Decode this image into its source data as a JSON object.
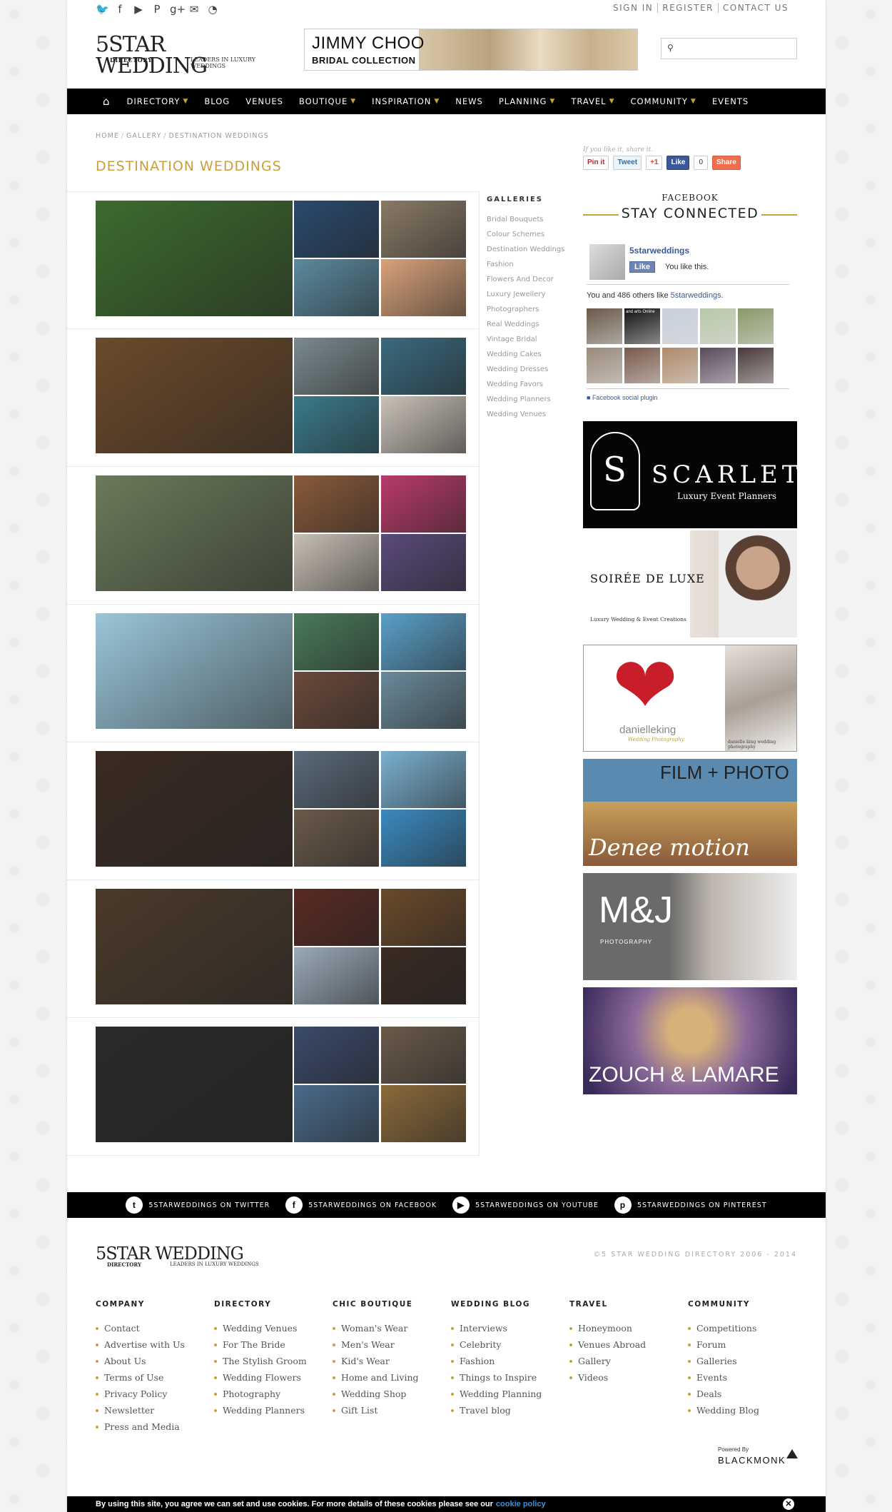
{
  "header": {
    "social_icons": [
      "twitter-icon",
      "facebook-icon",
      "youtube-icon",
      "pinterest-icon",
      "google-plus-icon",
      "mail-icon",
      "rss-icon"
    ],
    "top_links": [
      "SIGN IN",
      "REGISTER",
      "CONTACT US"
    ],
    "logo": {
      "main": "5STAR WEDDING",
      "sub_left": "DIRECTORY",
      "sub_right": "LEADERS IN LUXURY WEDDINGS"
    },
    "banner": {
      "line1": "JIMMY CHOO",
      "line2": "BRIDAL COLLECTION"
    },
    "search": {
      "placeholder": ""
    }
  },
  "nav": {
    "items": [
      {
        "label": "DIRECTORY",
        "dropdown": true
      },
      {
        "label": "BLOG",
        "dropdown": false
      },
      {
        "label": "VENUES",
        "dropdown": false
      },
      {
        "label": "BOUTIQUE",
        "dropdown": true
      },
      {
        "label": "INSPIRATION",
        "dropdown": true
      },
      {
        "label": "NEWS",
        "dropdown": false
      },
      {
        "label": "PLANNING",
        "dropdown": true
      },
      {
        "label": "TRAVEL",
        "dropdown": true
      },
      {
        "label": "COMMUNITY",
        "dropdown": true
      },
      {
        "label": "EVENTS",
        "dropdown": false
      }
    ]
  },
  "breadcrumb": [
    "HOME",
    "GALLERY",
    "DESTINATION WEDDINGS"
  ],
  "page_title": "DESTINATION WEDDINGS",
  "gallery_rows": [
    {
      "colors": [
        "#3d6b2e",
        "#2a4a6e",
        "#8a7a66",
        "#5b8a9e",
        "#d9a27a"
      ]
    },
    {
      "colors": [
        "#6b4a2a",
        "#7a8a8e",
        "#3a6a7e",
        "#3a7a8a",
        "#c9c2b8"
      ]
    },
    {
      "colors": [
        "#6a7a5a",
        "#8a5a3a",
        "#b93a6a",
        "#c8c0b5",
        "#5a4a7a"
      ]
    },
    {
      "colors": [
        "#9ac6d8",
        "#4a7a5a",
        "#5aa0c8",
        "#6a4a3a",
        "#6a8a9a"
      ]
    },
    {
      "colors": [
        "#3a2a22",
        "#5a6a7a",
        "#7ab0d0",
        "#6a5a4a",
        "#3a8ac0"
      ]
    },
    {
      "colors": [
        "#4a3a2a",
        "#5a2a22",
        "#6a4a2a",
        "#9aaab8",
        "#3a2a22"
      ]
    },
    {
      "colors": [
        "#2a2a2a",
        "#3a4a6a",
        "#6a5a4a",
        "#4a6a8a",
        "#8a6a3a"
      ]
    }
  ],
  "galleries": {
    "heading": "GALLERIES",
    "items": [
      "Bridal Bouquets",
      "Colour Schemes",
      "Destination Weddings",
      "Fashion",
      "Flowers And Decor",
      "Luxury Jewellery",
      "Photographers",
      "Real Weddings",
      "Vintage Bridal",
      "Wedding Cakes",
      "Wedding Dresses",
      "Wedding Favors",
      "Wedding Planners",
      "Wedding Venues"
    ]
  },
  "share": {
    "prompt": "If you like it, share it.",
    "pin": "Pin it",
    "tweet": "Tweet",
    "gplus": "+1",
    "like": "Like",
    "like_count": "0",
    "share": "Share"
  },
  "facebook": {
    "label": "FACEBOOK",
    "heading": "STAY CONNECTED",
    "page_name": "5starweddings",
    "like_button": "Like",
    "you_like": "You like this.",
    "others_prefix": "You and 486 others like ",
    "others_link": "5starweddings.",
    "plugin": "Facebook social plugin",
    "face_colors": [
      "#6a5a4a",
      "#111",
      "#c8d0dc",
      "#b8c8a8",
      "#8a9a6a",
      "#9a8a7a",
      "#7a5a4a",
      "#b08a6a",
      "#5a4a5a",
      "#4a3a3a"
    ],
    "face_caption": "and arts Online"
  },
  "ads": [
    {
      "title": "SCARLET",
      "subtitle": "Luxury Event Planners",
      "monogram": "S"
    },
    {
      "title": "SOIRÉE DE LUXE",
      "subtitle": "Luxury Wedding & Event Creations"
    },
    {
      "title": "danielleking",
      "subtitle": "Wedding Photography",
      "caption": "danielle king wedding photography"
    },
    {
      "title": "FILM + PHOTO",
      "subtitle": "Denee motion"
    },
    {
      "title": "M&J",
      "subtitle": "PHOTOGRAPHY"
    },
    {
      "title": "ZOUCH & LAMARE"
    }
  ],
  "social_bar": [
    {
      "icon": "twitter-icon",
      "glyph": "t",
      "label": "5STARWEDDINGS ON TWITTER"
    },
    {
      "icon": "facebook-icon",
      "glyph": "f",
      "label": "5STARWEDDINGS ON FACEBOOK"
    },
    {
      "icon": "youtube-icon",
      "glyph": "▶",
      "label": "5STARWEDDINGS ON YOUTUBE"
    },
    {
      "icon": "pinterest-icon",
      "glyph": "p",
      "label": "5STARWEDDINGS ON PINTEREST"
    }
  ],
  "footer": {
    "logo": {
      "main": "5STAR WEDDING",
      "sub_left": "DIRECTORY",
      "sub_right": "LEADERS IN LUXURY WEDDINGS"
    },
    "copyright": "©5 STAR WEDDING DIRECTORY 2006 - 2014",
    "columns": [
      {
        "heading": "COMPANY",
        "links": [
          "Contact",
          "Advertise with Us",
          "About Us",
          "Terms of Use",
          "Privacy Policy",
          "Newsletter",
          "Press and Media"
        ]
      },
      {
        "heading": "DIRECTORY",
        "links": [
          "Wedding Venues",
          "For The Bride",
          "The Stylish Groom",
          "Wedding Flowers",
          "Photography",
          "Wedding Planners"
        ]
      },
      {
        "heading": "CHIC BOUTIQUE",
        "links": [
          "Woman's Wear",
          "Men's Wear",
          "Kid's Wear",
          "Home and Living",
          "Wedding Shop",
          "Gift List"
        ]
      },
      {
        "heading": "WEDDING BLOG",
        "links": [
          "Interviews",
          "Celebrity",
          "Fashion",
          "Things to Inspire",
          "Wedding Planning",
          "Travel blog"
        ]
      },
      {
        "heading": "TRAVEL",
        "links": [
          "Honeymoon",
          "Venues Abroad",
          "Gallery",
          "Videos"
        ]
      },
      {
        "heading": "COMMUNITY",
        "links": [
          "Competitions",
          "Forum",
          "Galleries",
          "Events",
          "Deals",
          "Wedding Blog"
        ]
      }
    ],
    "powered_by": "Powered By",
    "brand": "BLACKMONK"
  },
  "cookie": {
    "text": "By using this site, you agree we can set and use cookies. For more details of these cookies please see our",
    "link": "cookie policy",
    "close": "✕"
  }
}
